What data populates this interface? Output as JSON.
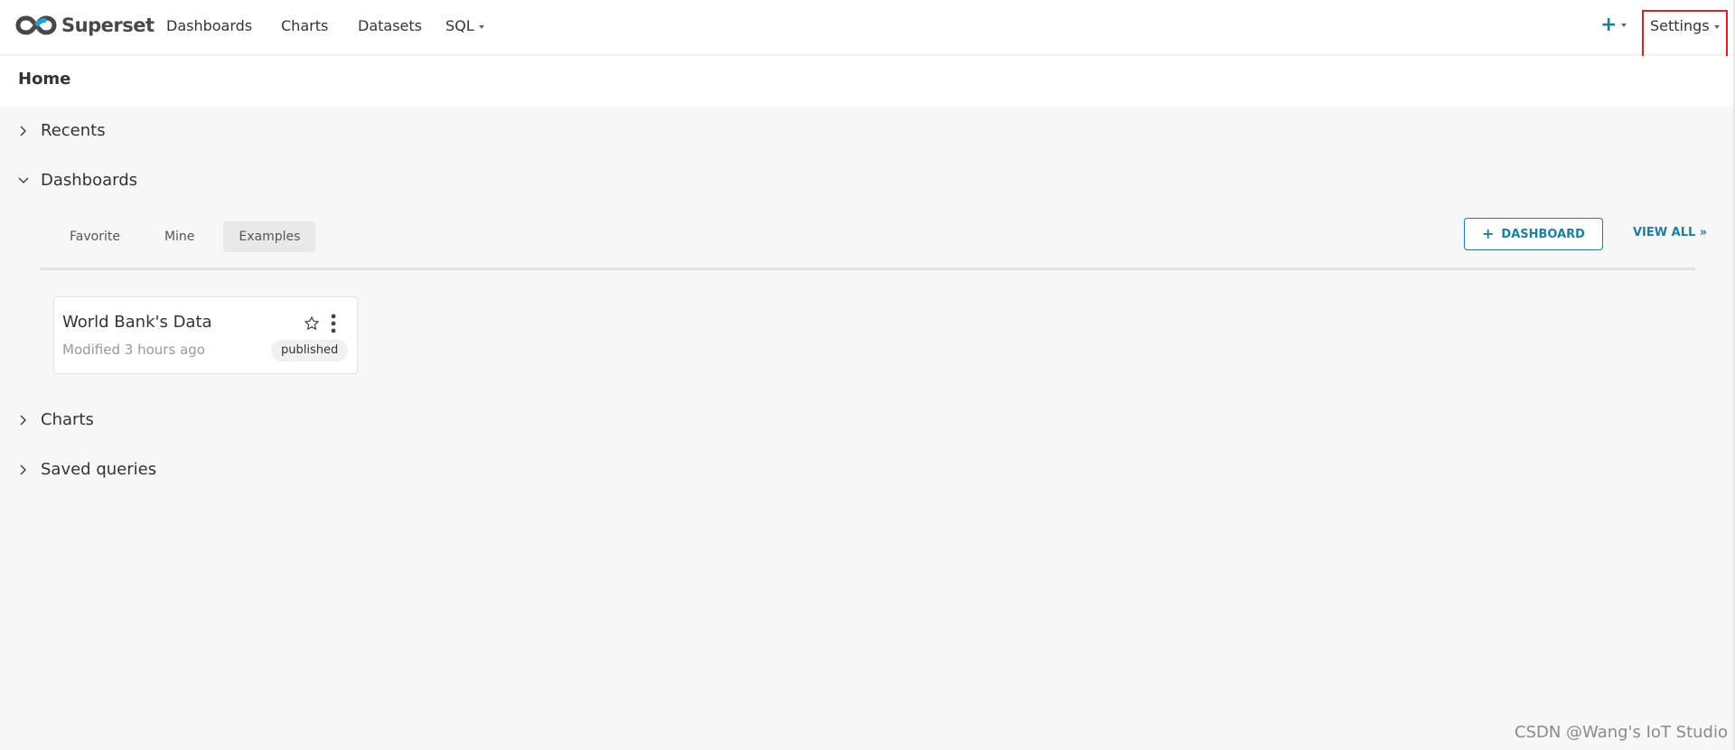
{
  "navbar": {
    "brand": "Superset",
    "items": [
      {
        "label": "Dashboards"
      },
      {
        "label": "Charts"
      },
      {
        "label": "Datasets"
      },
      {
        "label": "SQL"
      }
    ],
    "plus_icon": "plus-icon",
    "settings_label": "Settings"
  },
  "page": {
    "title": "Home"
  },
  "sections": {
    "recents": "Recents",
    "dashboards": "Dashboards",
    "charts": "Charts",
    "saved_queries": "Saved queries"
  },
  "dashboards": {
    "tabs": [
      "Favorite",
      "Mine",
      "Examples"
    ],
    "active_tab": "Examples",
    "add_button": "DASHBOARD",
    "view_all": "VIEW ALL »",
    "card": {
      "title": "World Bank's Data",
      "meta": "Modified 3 hours ago",
      "badge": "published"
    }
  },
  "watermark": "CSDN @Wang's IoT Studio",
  "colors": {
    "accent": "#1f7ea0",
    "highlight_box": "#e02020",
    "background": "#f7f7f7"
  }
}
